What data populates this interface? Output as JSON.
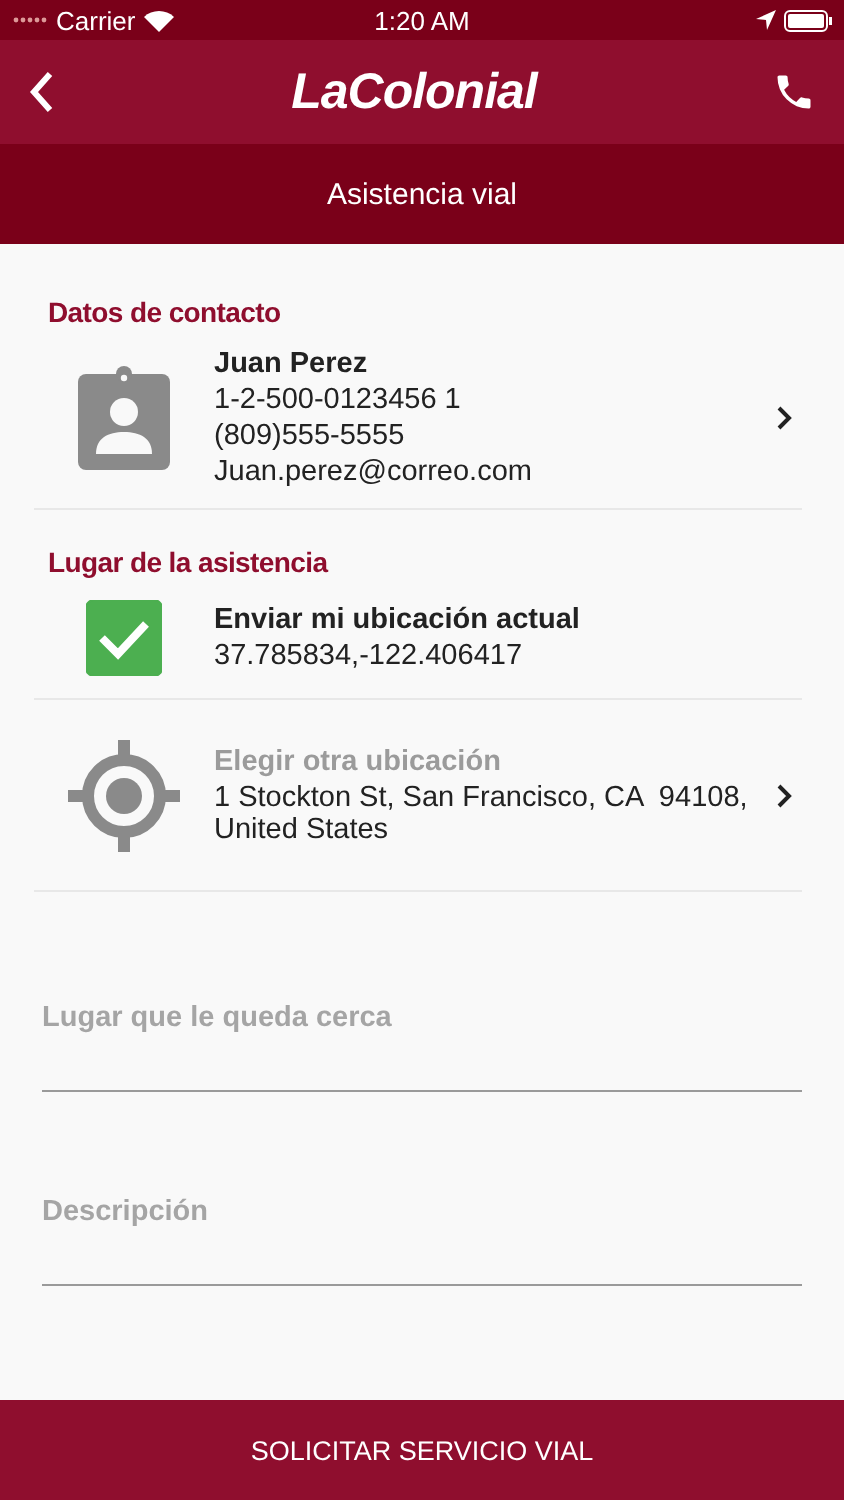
{
  "status_bar": {
    "carrier": "Carrier",
    "time": "1:20 AM"
  },
  "nav": {
    "logo": "LaColonial",
    "subtitle": "Asistencia vial"
  },
  "contact": {
    "heading": "Datos de contacto",
    "name": "Juan Perez",
    "lines": [
      "1-2-500-0123456 1",
      "(809)555-5555",
      "Juan.perez@correo.com"
    ]
  },
  "location": {
    "heading": "Lugar de la asistencia",
    "options": [
      {
        "kind": "current",
        "selected": true,
        "title": "Enviar mi ubicación actual",
        "detail": "37.785834,-122.406417"
      },
      {
        "kind": "address",
        "selected": false,
        "title": "Elegir otra ubicación",
        "detail": "1 Stockton St, San Francisco, CA  94108, United States"
      }
    ]
  },
  "fields": [
    {
      "placeholder": "Lugar que le queda cerca"
    },
    {
      "placeholder": "Descripción"
    }
  ],
  "submit": "SOLICITAR SERVICIO VIAL"
}
